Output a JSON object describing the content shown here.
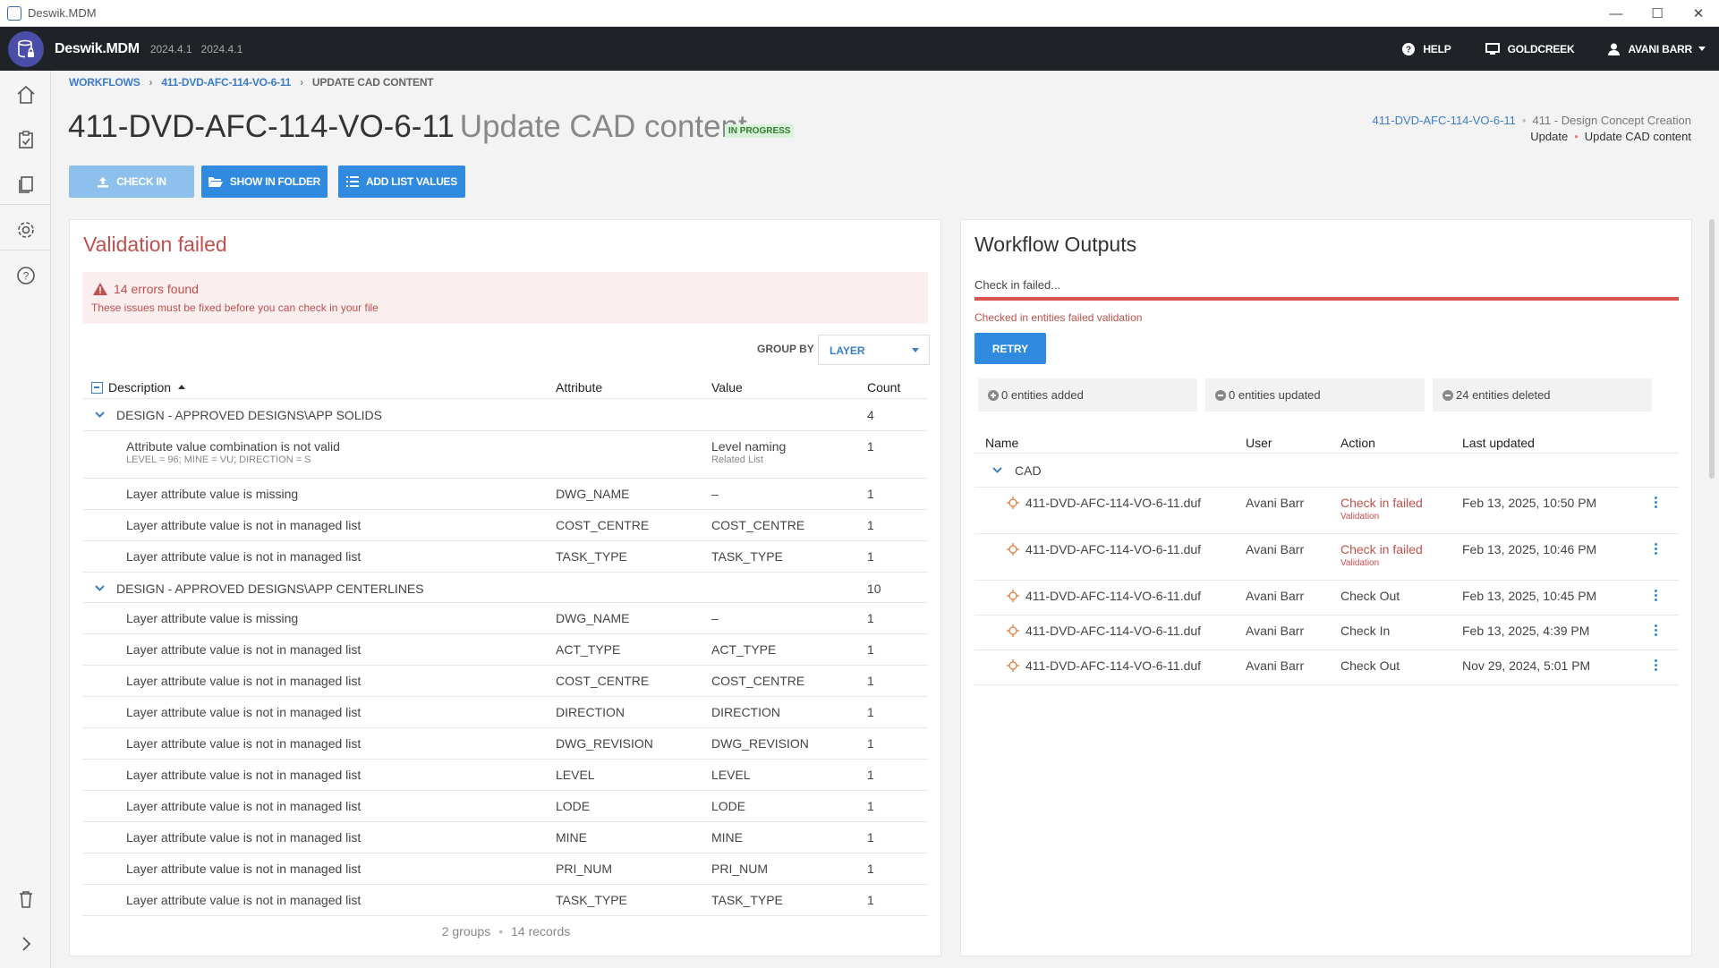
{
  "window": {
    "title": "Deswik.MDM",
    "minimize": "—",
    "maximize": "☐",
    "close": "✕"
  },
  "header": {
    "brand": "Deswik.MDM",
    "version1": "2024.4.1",
    "version2": "2024.4.1",
    "help": "HELP",
    "site": "GOLDCREEK",
    "user": "AVANI BARR"
  },
  "breadcrumb": [
    "WORKFLOWS",
    "411-DVD-AFC-114-VO-6-11",
    "UPDATE CAD CONTENT"
  ],
  "page": {
    "code": "411-DVD-AFC-114-VO-6-11",
    "task": "Update CAD content",
    "status": "IN PROGRESS"
  },
  "context": {
    "workflow_link": "411-DVD-AFC-114-VO-6-11",
    "stage": "411 - Design Concept Creation",
    "step": "Update",
    "task": "Update CAD content"
  },
  "buttons": {
    "check_in": "CHECK IN",
    "show_in_folder": "SHOW IN FOLDER",
    "add_list_values": "ADD LIST VALUES"
  },
  "validation": {
    "title": "Validation failed",
    "error_count": "14 errors found",
    "error_message": "These issues must be fixed before you can check in your file",
    "group_by_label": "GROUP BY",
    "group_by_value": "LAYER",
    "columns": {
      "description": "Description",
      "attribute": "Attribute",
      "value": "Value",
      "count": "Count"
    },
    "groups": [
      {
        "name": "DESIGN - APPROVED DESIGNS\\APP SOLIDS",
        "count": "4",
        "rows": [
          {
            "description": "Attribute value combination is not valid",
            "sub": "LEVEL = 96; MINE = VU; DIRECTION = S",
            "attribute": "",
            "value": "Level naming",
            "value_sub": "Related List",
            "count": "1"
          },
          {
            "description": "Layer attribute value is missing",
            "attribute": "DWG_NAME",
            "value": "–",
            "count": "1"
          },
          {
            "description": "Layer attribute value is not in managed list",
            "attribute": "COST_CENTRE",
            "value": "COST_CENTRE",
            "count": "1"
          },
          {
            "description": "Layer attribute value is not in managed list",
            "attribute": "TASK_TYPE",
            "value": "TASK_TYPE",
            "count": "1"
          }
        ]
      },
      {
        "name": "DESIGN - APPROVED DESIGNS\\APP CENTERLINES",
        "count": "10",
        "rows": [
          {
            "description": "Layer attribute value is missing",
            "attribute": "DWG_NAME",
            "value": "–",
            "count": "1"
          },
          {
            "description": "Layer attribute value is not in managed list",
            "attribute": "ACT_TYPE",
            "value": "ACT_TYPE",
            "count": "1"
          },
          {
            "description": "Layer attribute value is not in managed list",
            "attribute": "COST_CENTRE",
            "value": "COST_CENTRE",
            "count": "1"
          },
          {
            "description": "Layer attribute value is not in managed list",
            "attribute": "DIRECTION",
            "value": "DIRECTION",
            "count": "1"
          },
          {
            "description": "Layer attribute value is not in managed list",
            "attribute": "DWG_REVISION",
            "value": "DWG_REVISION",
            "count": "1"
          },
          {
            "description": "Layer attribute value is not in managed list",
            "attribute": "LEVEL",
            "value": "LEVEL",
            "count": "1"
          },
          {
            "description": "Layer attribute value is not in managed list",
            "attribute": "LODE",
            "value": "LODE",
            "count": "1"
          },
          {
            "description": "Layer attribute value is not in managed list",
            "attribute": "MINE",
            "value": "MINE",
            "count": "1"
          },
          {
            "description": "Layer attribute value is not in managed list",
            "attribute": "PRI_NUM",
            "value": "PRI_NUM",
            "count": "1"
          },
          {
            "description": "Layer attribute value is not in managed list",
            "attribute": "TASK_TYPE",
            "value": "TASK_TYPE",
            "count": "1"
          }
        ]
      }
    ],
    "footer_groups": "2 groups",
    "footer_records": "14 records"
  },
  "outputs": {
    "title": "Workflow Outputs",
    "progress_label": "Check in failed...",
    "progress_message": "Checked in entities failed validation",
    "retry": "RETRY",
    "stats": {
      "added": "0 entities added",
      "updated": "0 entities updated",
      "deleted": "24 entities deleted"
    },
    "columns": {
      "name": "Name",
      "user": "User",
      "action": "Action",
      "updated": "Last updated"
    },
    "group": "CAD",
    "rows": [
      {
        "name": "411-DVD-AFC-114-VO-6-11.duf",
        "user": "Avani Barr",
        "action": "Check in failed",
        "action_sub": "Validation",
        "updated": "Feb 13, 2025, 10:50 PM"
      },
      {
        "name": "411-DVD-AFC-114-VO-6-11.duf",
        "user": "Avani Barr",
        "action": "Check in failed",
        "action_sub": "Validation",
        "updated": "Feb 13, 2025, 10:46 PM"
      },
      {
        "name": "411-DVD-AFC-114-VO-6-11.duf",
        "user": "Avani Barr",
        "action": "Check Out",
        "updated": "Feb 13, 2025, 10:45 PM"
      },
      {
        "name": "411-DVD-AFC-114-VO-6-11.duf",
        "user": "Avani Barr",
        "action": "Check In",
        "updated": "Feb 13, 2025, 4:39 PM"
      },
      {
        "name": "411-DVD-AFC-114-VO-6-11.duf",
        "user": "Avani Barr",
        "action": "Check Out",
        "updated": "Nov 29, 2024, 5:01 PM"
      }
    ]
  }
}
